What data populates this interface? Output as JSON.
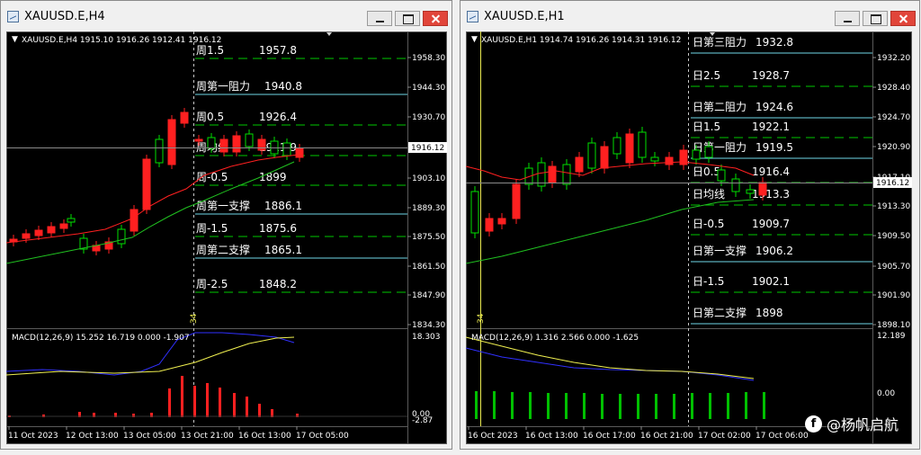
{
  "windows": [
    {
      "title": "XAUUSD.E,H4",
      "header": "XAUUSD.E,H4  1915.10 1916.26 1912.41 1916.12",
      "price_ticks": [
        "1958.30",
        "1944.30",
        "1930.70",
        "1903.10",
        "1889.30",
        "1875.50",
        "1861.50",
        "1847.90",
        "1834.30"
      ],
      "current_price": "1916.12",
      "macd_label": "MACD(12,26,9) 15.252 16.719 0.000 -1.907",
      "macd_ticks": [
        "18.303",
        "0.00",
        "-2.87"
      ],
      "time_ticks": [
        "11 Oct 2023",
        "12 Oct 13:00",
        "13 Oct 05:00",
        "13 Oct 21:00",
        "16 Oct 13:00",
        "17 Oct 05:00"
      ],
      "marker": "34",
      "levels": [
        {
          "name": "周1.5",
          "value": "1957.8"
        },
        {
          "name": "周第一阻力",
          "value": "1940.8"
        },
        {
          "name": "周0.5",
          "value": "1926.4"
        },
        {
          "name": "周均线",
          "value": "1911.9"
        },
        {
          "name": "周-0.5",
          "value": "1899"
        },
        {
          "name": "周第一支撑",
          "value": "1886.1"
        },
        {
          "name": "周-1.5",
          "value": "1875.6"
        },
        {
          "name": "周第二支撑",
          "value": "1865.1"
        },
        {
          "name": "周-2.5",
          "value": "1848.2"
        }
      ]
    },
    {
      "title": "XAUUSD.E,H1",
      "header": "XAUUSD.E,H1  1914.74 1916.26 1914.31 1916.12",
      "price_ticks": [
        "1932.20",
        "1928.40",
        "1924.70",
        "1920.90",
        "1917.10",
        "1913.30",
        "1909.50",
        "1905.70",
        "1901.90",
        "1898.10"
      ],
      "current_price": "1916.12",
      "macd_label": "MACD(12,26,9) 1.316 2.566 0.000 -1.625",
      "macd_ticks": [
        "12.189",
        "0.00"
      ],
      "time_ticks": [
        "16 Oct 2023",
        "16 Oct 13:00",
        "16 Oct 17:00",
        "16 Oct 21:00",
        "17 Oct 02:00",
        "17 Oct 06:00"
      ],
      "marker": "34",
      "levels": [
        {
          "name": "日第三阻力",
          "value": "1932.8"
        },
        {
          "name": "日2.5",
          "value": "1928.7"
        },
        {
          "name": "日第二阻力",
          "value": "1924.6"
        },
        {
          "name": "日1.5",
          "value": "1922.1"
        },
        {
          "name": "日第一阻力",
          "value": "1919.5"
        },
        {
          "name": "日0.5",
          "value": "1916.4"
        },
        {
          "name": "日均线",
          "value": "1913.3"
        },
        {
          "name": "日-0.5",
          "value": "1909.7"
        },
        {
          "name": "日第一支撑",
          "value": "1906.2"
        },
        {
          "name": "日-1.5",
          "value": "1902.1"
        },
        {
          "name": "日第二支撑",
          "value": "1898"
        }
      ]
    }
  ],
  "watermark": {
    "logo": "f",
    "text": "@杨帆启航"
  },
  "colors": {
    "up": "#00e000",
    "down": "#ff2020",
    "grid": "#404040",
    "level": "#00c800",
    "resist": "#70d8e8",
    "ma_fast": "#ff2020",
    "ma_slow": "#20d020",
    "macd": "#3030ff",
    "signal": "#f0f050",
    "marker": "#e8e850"
  }
}
